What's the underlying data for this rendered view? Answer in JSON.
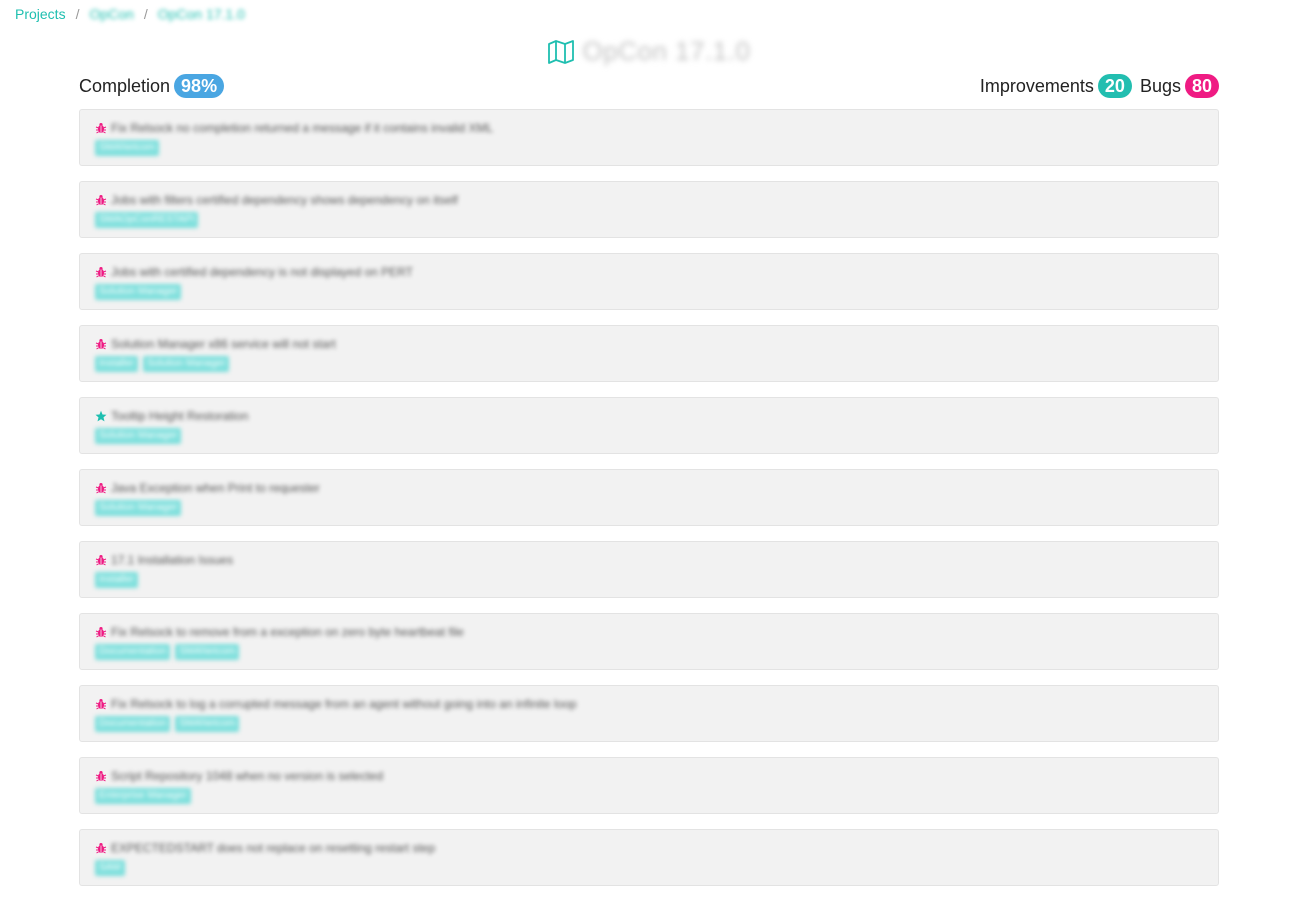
{
  "breadcrumb": {
    "root": "Projects",
    "project": "OpCon",
    "release": "OpCon 17.1.0",
    "separator": "/"
  },
  "page": {
    "title": "OpCon 17.1.0",
    "icon": "map-icon"
  },
  "stats": {
    "completion_label": "Completion",
    "completion_value": "98%",
    "improvements_label": "Improvements",
    "improvements_value": "20",
    "bugs_label": "Bugs",
    "bugs_value": "80"
  },
  "colors": {
    "accent": "#1fbfb0",
    "completion": "#4aa6e2",
    "improvements": "#22beb0",
    "bugs": "#ef1b83",
    "tag": "#7ddfdc"
  },
  "items": [
    {
      "type": "bug",
      "icon": "bug-icon",
      "title": "Fix Relsock no completion returned a message if it contains invalid XML",
      "tags": [
        "SMANetcom"
      ]
    },
    {
      "type": "bug",
      "icon": "bug-icon",
      "title": "Jobs with filters certified dependency shows dependency on itself",
      "tags": [
        "SMAOpConRESTAPI"
      ]
    },
    {
      "type": "bug",
      "icon": "bug-icon",
      "title": "Jobs with certified dependency is not displayed on PERT",
      "tags": [
        "Solution Manager"
      ]
    },
    {
      "type": "bug",
      "icon": "bug-icon",
      "title": "Solution Manager x86 service will not start",
      "tags": [
        "Installer",
        "Solution Manager"
      ]
    },
    {
      "type": "improvement",
      "icon": "star-icon",
      "title": "Tooltip Height Restoration",
      "tags": [
        "Solution Manager"
      ]
    },
    {
      "type": "bug",
      "icon": "bug-icon",
      "title": "Java Exception when Print to requester",
      "tags": [
        "Solution Manager"
      ]
    },
    {
      "type": "bug",
      "icon": "bug-icon",
      "title": "17.1 Installation Issues",
      "tags": [
        "Installer"
      ]
    },
    {
      "type": "bug",
      "icon": "bug-icon",
      "title": "Fix Relsock to remove from a exception on zero byte heartbeat file",
      "tags": [
        "Documentation",
        "SMANetcom"
      ]
    },
    {
      "type": "bug",
      "icon": "bug-icon",
      "title": "Fix Relsock to log a corrupted message from an agent without going into an infinite loop",
      "tags": [
        "Documentation",
        "SMANetcom"
      ]
    },
    {
      "type": "bug",
      "icon": "bug-icon",
      "title": "Script Repository 1048 when no version is selected",
      "tags": [
        "Enterprise Manager"
      ]
    },
    {
      "type": "bug",
      "icon": "bug-icon",
      "title": "EXPECTEDSTART does not replace on resetting restart step",
      "tags": [
        "SAM"
      ]
    }
  ]
}
